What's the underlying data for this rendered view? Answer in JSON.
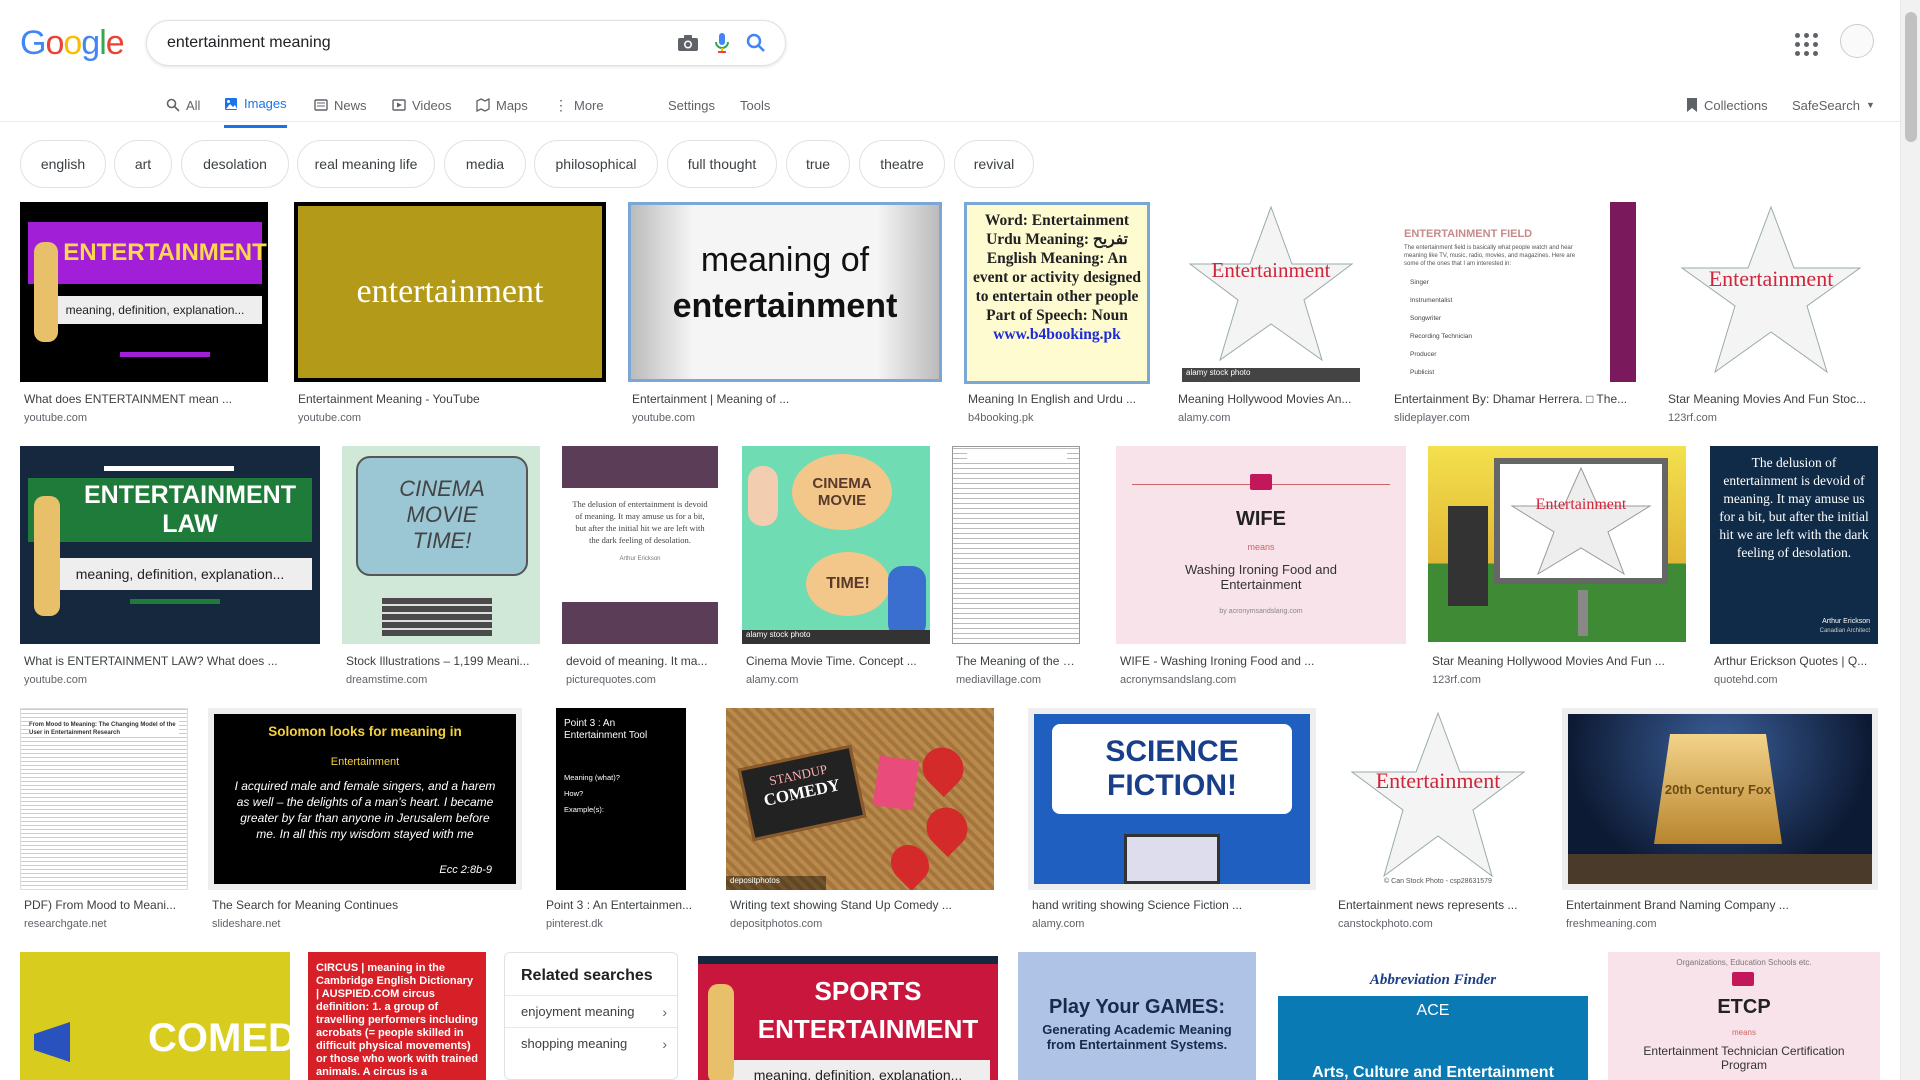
{
  "header": {
    "logo": "Google",
    "search_value": "entertainment meaning"
  },
  "tabs": {
    "all": "All",
    "images": "Images",
    "news": "News",
    "videos": "Videos",
    "maps": "Maps",
    "more": "More",
    "settings": "Settings",
    "tools": "Tools",
    "collections": "Collections",
    "safesearch": "SafeSearch"
  },
  "chips": [
    "english",
    "art",
    "desolation",
    "real meaning life",
    "media",
    "philosophical",
    "full thought",
    "true",
    "theatre",
    "revival"
  ],
  "results": [
    {
      "caption": "What does ENTERTAINMENT mean ...",
      "source": "youtube.com"
    },
    {
      "caption": "Entertainment Meaning - YouTube",
      "source": "youtube.com"
    },
    {
      "caption": "Entertainment | Meaning of ...",
      "source": "youtube.com"
    },
    {
      "caption": "Meaning In English and Urdu ...",
      "source": "b4booking.pk"
    },
    {
      "caption": "Meaning Hollywood Movies An...",
      "source": "alamy.com"
    },
    {
      "caption": "Entertainment By: Dhamar Herrera. □ The...",
      "source": "slideplayer.com"
    },
    {
      "caption": "Star Meaning Movies And Fun Stoc...",
      "source": "123rf.com"
    },
    {
      "caption": "What is ENTERTAINMENT LAW? What does ...",
      "source": "youtube.com"
    },
    {
      "caption": "Stock Illustrations – 1,199 Meani...",
      "source": "dreamstime.com"
    },
    {
      "caption": "devoid of meaning. It ma...",
      "source": "picturequotes.com"
    },
    {
      "caption": "Cinema Movie Time. Concept ...",
      "source": "alamy.com"
    },
    {
      "caption": "The Meaning of the M...",
      "source": "mediavillage.com"
    },
    {
      "caption": "WIFE - Washing Ironing Food and ...",
      "source": "acronymsandslang.com"
    },
    {
      "caption": "Star Meaning Hollywood Movies And Fun ...",
      "source": "123rf.com"
    },
    {
      "caption": "Arthur Erickson Quotes | Q...",
      "source": "quotehd.com"
    },
    {
      "caption": "PDF) From Mood to Meani...",
      "source": "researchgate.net"
    },
    {
      "caption": "The Search for Meaning Continues",
      "source": "slideshare.net"
    },
    {
      "caption": "Point 3 : An Entertainmen...",
      "source": "pinterest.dk"
    },
    {
      "caption": "Writing text showing Stand Up Comedy ...",
      "source": "depositphotos.com"
    },
    {
      "caption": "hand writing showing Science Fiction ...",
      "source": "alamy.com"
    },
    {
      "caption": "Entertainment news represents ...",
      "source": "canstockphoto.com"
    },
    {
      "caption": "Entertainment Brand Naming Company ...",
      "source": "freshmeaning.com"
    }
  ],
  "thumbs": {
    "t1_title": "ENTERTAINMENT",
    "t1_sub": "meaning, definition, explanation...",
    "t2": "entertainment",
    "t3_a": "meaning of",
    "t3_b": "entertainment",
    "t4_lines": [
      "Word: Entertainment",
      "Urdu Meaning: تفریح",
      "English Meaning: An",
      "event or activity designed",
      "to entertain other people",
      "Part of Speech: Noun",
      "www.b4booking.pk"
    ],
    "star_word": "Entertainment",
    "alamy": "alamy stock photo",
    "t6_title": "ENTERTAINMENT FIELD",
    "t6_body": "The entertainment field is basically what people watch and hear meaning like TV, music, radio, movies, and magazines. Here are some of the ones that I am interested in:",
    "t6_items": [
      "Singer",
      "Instrumentalist",
      "Songwriter",
      "Recording Technician",
      "Producer",
      "Publicist"
    ],
    "t8_title": "ENTERTAINMENT LAW",
    "t8_sub": "meaning, definition, explanation...",
    "t9_lines": [
      "CINEMA",
      "MOVIE",
      "TIME!"
    ],
    "t10_quote": "The delusion of entertainment is devoid of meaning. It may amuse us for a bit, but after the initial hit we are left with the dark feeling of desolation.",
    "t10_author": "Arthur Erickson",
    "t11_a": "CINEMA MOVIE",
    "t11_b": "TIME!",
    "t13_title": "WIFE",
    "t13_means": "means",
    "t13_def": "Washing Ironing Food and Entertainment",
    "t13_by": "by acronymsandslang.com",
    "t15_quote": "The delusion of entertainment is devoid of meaning. It may amuse us for a bit, but after the initial hit we are left with the dark feeling of desolation.",
    "t15_author": "Arthur Erickson",
    "t15_role": "Canadian Architect",
    "t16_title": "From Mood to Meaning: The Changing Model of the User in Entertainment Research",
    "t17_head": "Solomon looks for meaning in",
    "t17_word": "Entertainment",
    "t17_body": "I acquired male and female singers, and a harem as well – the delights of a man’s heart. I became greater by far than anyone in Jerusalem before me. In all this my wisdom stayed with me",
    "t17_ref": "Ecc 2:8b-9",
    "t18_title": "Point 3 : An Entertainment Tool",
    "t18_lines": [
      "Meaning (what)?",
      "How?",
      "Example(s):"
    ],
    "t19_a": "STANDUP",
    "t19_b": "COMEDY",
    "t19_wm": "depositphotos",
    "t20": "SCIENCE FICTION!",
    "t21_credit": "© Can Stock Photo - csp28631579",
    "t22": "20th Century Fox",
    "r4_1": "COMEDY!",
    "r4_2": "CIRCUS | meaning in the Cambridge English Dictionary | AUSPIED.COM circus definition: 1. a group of travelling performers including acrobats (= people skilled in difficult physical movements) or those who work with trained animals. A circus is a company of",
    "r4_4a": "SPORTS",
    "r4_4b": "ENTERTAINMENT",
    "r4_4c": "meaning, definition, explanation...",
    "r4_5a": "Play Your GAMES:",
    "r4_5b": "Generating Academic Meaning from Entertainment Systems.",
    "r4_6a": "Abbreviation Finder",
    "r4_6b": "ACE",
    "r4_6c": "Arts, Culture and Entertainment",
    "r4_7a": "Organizations, Education Schools etc.",
    "r4_7b": "ETCP",
    "r4_7c": "means",
    "r4_7d": "Entertainment Technician Certification Program"
  },
  "related": {
    "title": "Related searches",
    "items": [
      "enjoyment meaning",
      "shopping meaning"
    ]
  }
}
